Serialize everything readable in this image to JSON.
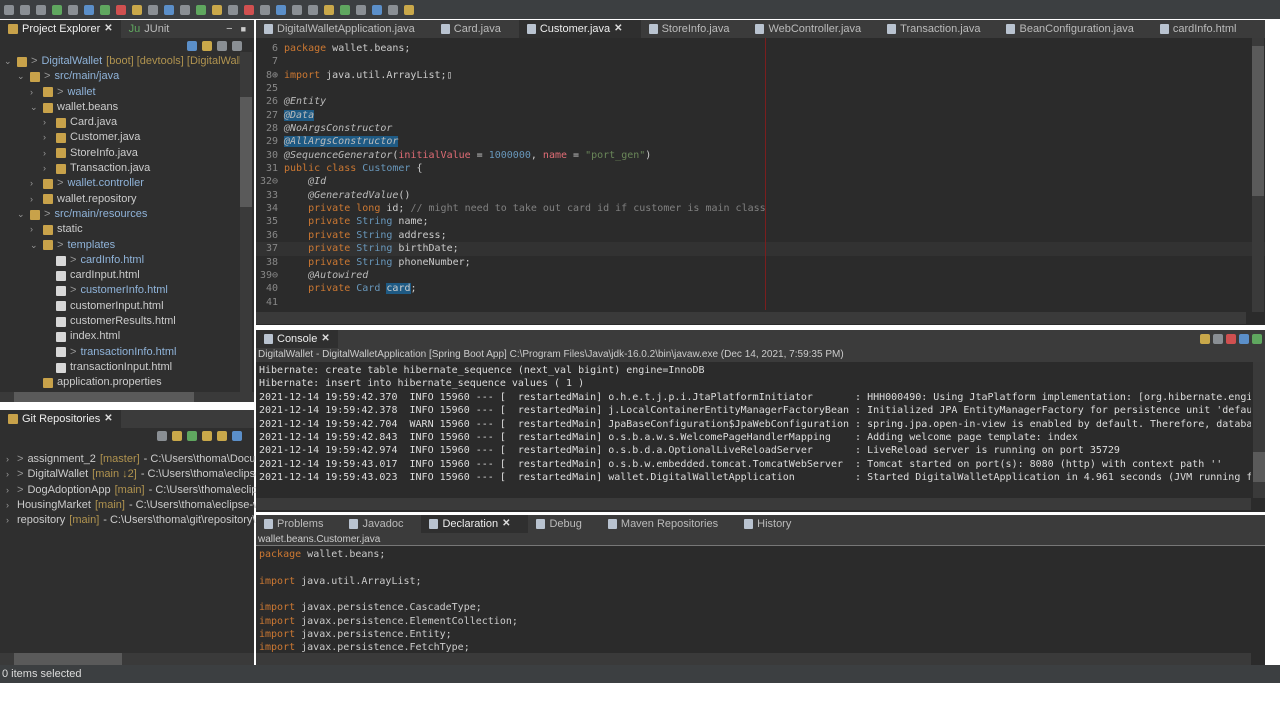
{
  "window_controls": {
    "minimize": "−",
    "maximize": "■"
  },
  "project_explorer": {
    "tabs": [
      {
        "label": "Project Explorer"
      },
      {
        "label": "JUnit"
      }
    ],
    "items": [
      {
        "label": "DigitalWallet",
        "extra": "[boot] [devtools] [DigitalWallet",
        "depth": 0,
        "expanded": true,
        "prefix": ">"
      },
      {
        "label": "src/main/java",
        "depth": 1,
        "expanded": true,
        "prefix": ">"
      },
      {
        "label": "wallet",
        "depth": 2,
        "expanded": false,
        "prefix": ">"
      },
      {
        "label": "wallet.beans",
        "depth": 2,
        "expanded": true,
        "prefix": ""
      },
      {
        "label": "Card.java",
        "depth": 3,
        "expanded": false,
        "prefix": ""
      },
      {
        "label": "Customer.java",
        "depth": 3,
        "expanded": false,
        "prefix": ""
      },
      {
        "label": "StoreInfo.java",
        "depth": 3,
        "expanded": false,
        "prefix": ""
      },
      {
        "label": "Transaction.java",
        "depth": 3,
        "expanded": false,
        "prefix": ""
      },
      {
        "label": "wallet.controller",
        "depth": 2,
        "expanded": false,
        "prefix": ">"
      },
      {
        "label": "wallet.repository",
        "depth": 2,
        "expanded": false,
        "prefix": ""
      },
      {
        "label": "src/main/resources",
        "depth": 1,
        "expanded": true,
        "prefix": ">"
      },
      {
        "label": "static",
        "depth": 2,
        "expanded": false,
        "prefix": ""
      },
      {
        "label": "templates",
        "depth": 2,
        "expanded": true,
        "prefix": ">"
      },
      {
        "label": "cardInfo.html",
        "depth": 3,
        "prefix": ">"
      },
      {
        "label": "cardInput.html",
        "depth": 3,
        "prefix": ""
      },
      {
        "label": "customerInfo.html",
        "depth": 3,
        "prefix": ">"
      },
      {
        "label": "customerInput.html",
        "depth": 3,
        "prefix": ""
      },
      {
        "label": "customerResults.html",
        "depth": 3,
        "prefix": ""
      },
      {
        "label": "index.html",
        "depth": 3,
        "prefix": ""
      },
      {
        "label": "transactionInfo.html",
        "depth": 3,
        "prefix": ">"
      },
      {
        "label": "transactionInput.html",
        "depth": 3,
        "prefix": ""
      },
      {
        "label": "application.properties",
        "depth": 2,
        "prefix": ""
      }
    ]
  },
  "git_repositories": {
    "title": "Git Repositories",
    "items": [
      {
        "prefix": ">",
        "name": "assignment_2",
        "branch": "[master]",
        "path": "- C:\\Users\\thoma\\Docume"
      },
      {
        "prefix": ">",
        "name": "DigitalWallet",
        "branch": "[main ↓2]",
        "path": "- C:\\Users\\thoma\\eclipse"
      },
      {
        "prefix": ">",
        "name": "DogAdoptionApp",
        "branch": "[main]",
        "path": "- C:\\Users\\thoma\\eclip"
      },
      {
        "prefix": "",
        "name": "HousingMarket",
        "branch": "[main]",
        "path": "- C:\\Users\\thoma\\eclipse-w"
      },
      {
        "prefix": "",
        "name": "repository",
        "branch": "[main]",
        "path": "- C:\\Users\\thoma\\git\\repository\\"
      }
    ]
  },
  "editor": {
    "tabs": [
      {
        "label": "DigitalWalletApplication.java"
      },
      {
        "label": "Card.java"
      },
      {
        "label": "Customer.java",
        "active": true
      },
      {
        "label": "StoreInfo.java"
      },
      {
        "label": "WebController.java"
      },
      {
        "label": "Transaction.java"
      },
      {
        "label": "BeanConfiguration.java"
      },
      {
        "label": "cardInfo.html"
      }
    ],
    "lines": [
      {
        "n": "6",
        "html": "<span class='kw'>package</span> wallet.beans;"
      },
      {
        "n": "7",
        "html": ""
      },
      {
        "n": "8⊕",
        "html": "<span class='kw'>import</span> java.util.ArrayList;▯"
      },
      {
        "n": "25",
        "html": ""
      },
      {
        "n": "26",
        "html": "<span class='an'>@Entity</span>"
      },
      {
        "n": "27",
        "html": "<span class='an hl'>@Data</span>"
      },
      {
        "n": "28",
        "html": "<span class='an'>@NoArgsConstructor</span>"
      },
      {
        "n": "29",
        "html": "<span class='an hl'>@AllArgsConstructor</span>"
      },
      {
        "n": "30",
        "html": "<span class='an'>@SequenceGenerator</span>(<span class='pr'>initialValue</span> = <span class='ty'>1000000</span>, <span class='pr'>name</span> = <span class='st'>\"port_gen\"</span>)"
      },
      {
        "n": "31",
        "html": "<span class='kw'>public class</span> <span class='ty'>Customer</span> {"
      },
      {
        "n": "32⊖",
        "html": "    <span class='an'>@Id</span>"
      },
      {
        "n": "33",
        "html": "    <span class='an'>@GeneratedValue</span>()"
      },
      {
        "n": "34",
        "html": "    <span class='kw'>private long</span> id; <span class='cm'>// might need to take out card id if customer is main class</span>"
      },
      {
        "n": "35",
        "html": "    <span class='kw'>private</span> <span class='ty'>String</span> name;"
      },
      {
        "n": "36",
        "html": "    <span class='kw'>private</span> <span class='ty'>String</span> address;"
      },
      {
        "n": "37",
        "html": "    <span class='kw'>private</span> <span class='ty'>String</span> birthDate;"
      },
      {
        "n": "38",
        "html": "    <span class='kw'>private</span> <span class='ty'>String</span> phoneNumber;"
      },
      {
        "n": "39⊖",
        "html": "    <span class='an'>@Autowired</span>"
      },
      {
        "n": "40",
        "html": "    <span class='kw'>private</span> <span class='ty'>Card</span> <span class='hl'>card</span>;"
      },
      {
        "n": "41",
        "html": ""
      }
    ]
  },
  "console": {
    "tab": "Console",
    "description": "DigitalWallet - DigitalWalletApplication [Spring Boot App] C:\\Program Files\\Java\\jdk-16.0.2\\bin\\javaw.exe  (Dec 14, 2021, 7:59:35 PM)",
    "lines": [
      "Hibernate: create table hibernate_sequence (next_val bigint) engine=InnoDB",
      "Hibernate: insert into hibernate_sequence values ( 1 )",
      "2021-12-14 19:59:42.370  INFO 15960 --- [  restartedMain] o.h.e.t.j.p.i.JtaPlatformInitiator       : HHH000490: Using JtaPlatform implementation: [org.hibernate.engi",
      "2021-12-14 19:59:42.378  INFO 15960 --- [  restartedMain] j.LocalContainerEntityManagerFactoryBean : Initialized JPA EntityManagerFactory for persistence unit 'defau",
      "2021-12-14 19:59:42.704  WARN 15960 --- [  restartedMain] JpaBaseConfiguration$JpaWebConfiguration : spring.jpa.open-in-view is enabled by default. Therefore, databa",
      "2021-12-14 19:59:42.843  INFO 15960 --- [  restartedMain] o.s.b.a.w.s.WelcomePageHandlerMapping    : Adding welcome page template: index",
      "2021-12-14 19:59:42.974  INFO 15960 --- [  restartedMain] o.s.b.d.a.OptionalLiveReloadServer       : LiveReload server is running on port 35729",
      "2021-12-14 19:59:43.017  INFO 15960 --- [  restartedMain] o.s.b.w.embedded.tomcat.TomcatWebServer  : Tomcat started on port(s): 8080 (http) with context path ''",
      "2021-12-14 19:59:43.023  INFO 15960 --- [  restartedMain] wallet.DigitalWalletApplication          : Started DigitalWalletApplication in 4.961 seconds (JVM running f"
    ]
  },
  "bottom": {
    "tabs": [
      {
        "label": "Problems"
      },
      {
        "label": "Javadoc"
      },
      {
        "label": "Declaration",
        "active": true
      },
      {
        "label": "Debug"
      },
      {
        "label": "Maven Repositories"
      },
      {
        "label": "History"
      }
    ],
    "path": "wallet.beans.Customer.java",
    "lines": [
      "<span class='kw'>package</span> wallet.beans;",
      "",
      "<span class='kw'>import</span> java.util.ArrayList;",
      "",
      "<span class='kw'>import</span> javax.persistence.CascadeType;",
      "<span class='kw'>import</span> javax.persistence.ElementCollection;",
      "<span class='kw'>import</span> javax.persistence.Entity;",
      "<span class='kw'>import</span> javax.persistence.FetchType;"
    ]
  },
  "status": {
    "text": "0 items selected"
  }
}
